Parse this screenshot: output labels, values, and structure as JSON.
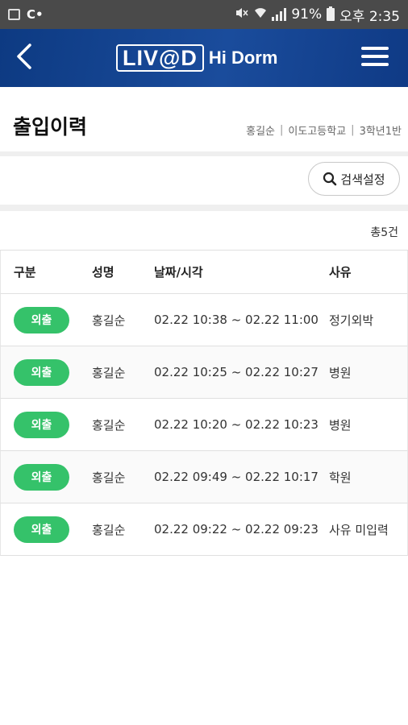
{
  "status_bar": {
    "battery": "91%",
    "time": "오후 2:35"
  },
  "header": {
    "logo_main": "LIV@D",
    "logo_sub": "Hi Dorm"
  },
  "page": {
    "title": "출입이력",
    "user_name": "홍길순",
    "school": "이도고등학교",
    "class": "3학년1반"
  },
  "search": {
    "label": "검색설정"
  },
  "summary": {
    "total": "총5건"
  },
  "table": {
    "headers": [
      "구분",
      "성명",
      "날짜/시각",
      "사유"
    ],
    "rows": [
      {
        "type": "외출",
        "name": "홍길순",
        "datetime": "02.22 10:38 ~ 02.22 11:00",
        "reason": "정기외박"
      },
      {
        "type": "외출",
        "name": "홍길순",
        "datetime": "02.22 10:25 ~ 02.22 10:27",
        "reason": "병원"
      },
      {
        "type": "외출",
        "name": "홍길순",
        "datetime": "02.22 10:20 ~ 02.22 10:23",
        "reason": "병원"
      },
      {
        "type": "외출",
        "name": "홍길순",
        "datetime": "02.22 09:49 ~ 02.22 10:17",
        "reason": "학원"
      },
      {
        "type": "외출",
        "name": "홍길순",
        "datetime": "02.22 09:22 ~ 02.22 09:23",
        "reason": "사유 미입력"
      }
    ]
  },
  "colors": {
    "header_bg": "#0d3a82",
    "badge_green": "#35c26a",
    "status_bar": "#4a4a4a"
  },
  "icons": [
    "gallery-icon",
    "c-icon",
    "mute-icon",
    "wifi-icon",
    "signal-icon",
    "battery-icon",
    "back-icon",
    "menu-icon",
    "search-icon"
  ]
}
